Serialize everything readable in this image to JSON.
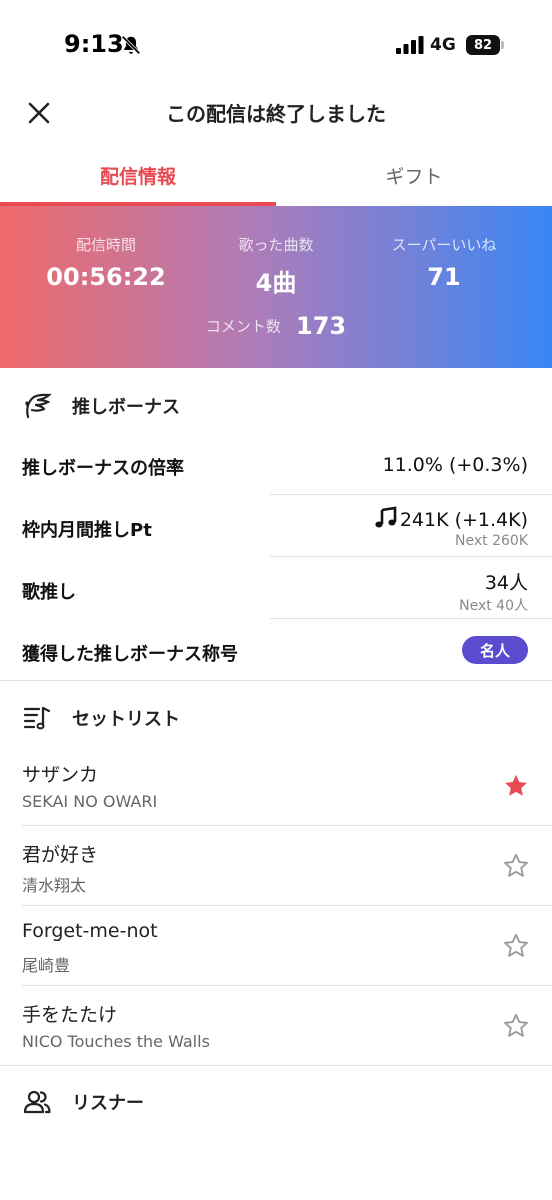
{
  "status_bar": {
    "time": "9:13",
    "network": "4G",
    "battery": "82"
  },
  "header": {
    "title": "この配信は終了しました"
  },
  "tabs": [
    {
      "label": "配信情報",
      "active": true
    },
    {
      "label": "ギフト",
      "active": false
    }
  ],
  "stats": {
    "duration_label": "配信時間",
    "duration_value": "00:56:22",
    "songs_label": "歌った曲数",
    "songs_value": "4曲",
    "superlike_label": "スーパーいいね",
    "superlike_value": "71",
    "comments_label": "コメント数",
    "comments_value": "173"
  },
  "bonus": {
    "section_title": "推しボーナス",
    "multiplier_label": "推しボーナスの倍率",
    "multiplier_value": "11.0% (+0.3%)",
    "monthly_label": "枠内月間推しPt",
    "monthly_value": "241K (+1.4K)",
    "monthly_next": "Next 260K",
    "song_oshi_label": "歌推し",
    "song_oshi_value": "34人",
    "song_oshi_next": "Next 40人",
    "title_label": "獲得した推しボーナス称号",
    "title_badge": "名人"
  },
  "setlist": {
    "section_title": "セットリスト",
    "songs": [
      {
        "title": "サザンカ",
        "artist": "SEKAI NO OWARI",
        "starred": true
      },
      {
        "title": "君が好き",
        "artist": "清水翔太",
        "starred": false
      },
      {
        "title": "Forget-me-not",
        "artist": "尾崎豊",
        "starred": false
      },
      {
        "title": "手をたたけ",
        "artist": "NICO Touches the Walls",
        "starred": false
      }
    ]
  },
  "listeners": {
    "section_title": "リスナー"
  },
  "colors": {
    "accent": "#e84b52",
    "badge": "#5a4bcf",
    "star_filled": "#e84b52",
    "star_empty": "#9a9a9a"
  }
}
